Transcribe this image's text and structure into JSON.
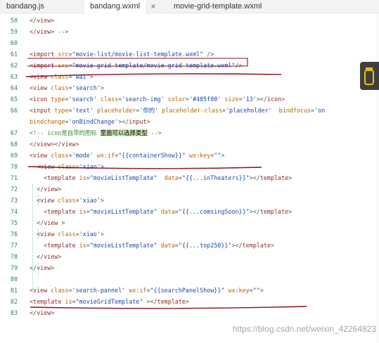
{
  "tabs": [
    {
      "label": "bandang.js",
      "active": false
    },
    {
      "label": "bandang.wxml",
      "active": true,
      "close": "×"
    },
    {
      "label": "movie-grid-template.wxml",
      "active": false
    }
  ],
  "lines": [
    {
      "no": "58",
      "segs": [
        {
          "c": "p",
          "t": "</"
        },
        {
          "c": "t",
          "t": "view"
        },
        {
          "c": "p",
          "t": ">"
        }
      ]
    },
    {
      "no": "59",
      "segs": [
        {
          "c": "p",
          "t": "</"
        },
        {
          "c": "t",
          "t": "view"
        },
        {
          "c": "p",
          "t": "> -->"
        }
      ]
    },
    {
      "no": "60",
      "segs": []
    },
    {
      "no": "61",
      "segs": [
        {
          "c": "p",
          "t": "<"
        },
        {
          "c": "t",
          "t": "import"
        },
        {
          "c": "a",
          "t": " src"
        },
        {
          "c": "p",
          "t": "="
        },
        {
          "c": "s",
          "t": "\"movie-list/movie-list-template.wxml\""
        },
        {
          "c": "p",
          "t": " />"
        }
      ]
    },
    {
      "no": "62",
      "segs": [
        {
          "c": "p",
          "t": "<"
        },
        {
          "c": "t",
          "t": "import"
        },
        {
          "c": "a",
          "t": " src"
        },
        {
          "c": "p",
          "t": "="
        },
        {
          "c": "s",
          "t": "\"movie-grid-template/movie-grid-template.wxml\""
        },
        {
          "c": "p",
          "t": "/>"
        }
      ]
    },
    {
      "no": "63",
      "segs": [
        {
          "c": "p",
          "t": "<"
        },
        {
          "c": "t",
          "t": "view"
        },
        {
          "c": "a",
          "t": " class"
        },
        {
          "c": "p",
          "t": "="
        },
        {
          "c": "s",
          "t": "'wai'"
        },
        {
          "c": "p",
          "t": ">"
        }
      ]
    },
    {
      "no": "64",
      "segs": [
        {
          "c": "p",
          "t": "<"
        },
        {
          "c": "t",
          "t": "view"
        },
        {
          "c": "a",
          "t": " class"
        },
        {
          "c": "p",
          "t": "="
        },
        {
          "c": "s",
          "t": "'search'"
        },
        {
          "c": "p",
          "t": ">"
        }
      ]
    },
    {
      "no": "65",
      "segs": [
        {
          "c": "p",
          "t": "<"
        },
        {
          "c": "t",
          "t": "icon"
        },
        {
          "c": "a",
          "t": " type"
        },
        {
          "c": "p",
          "t": "="
        },
        {
          "c": "s",
          "t": "'search'"
        },
        {
          "c": "a",
          "t": " class"
        },
        {
          "c": "p",
          "t": "="
        },
        {
          "c": "s",
          "t": "'search-img'"
        },
        {
          "c": "a",
          "t": " color"
        },
        {
          "c": "p",
          "t": "="
        },
        {
          "c": "s",
          "t": "'#405f80'"
        },
        {
          "c": "a",
          "t": " size"
        },
        {
          "c": "p",
          "t": "="
        },
        {
          "c": "s",
          "t": "'13'"
        },
        {
          "c": "p",
          "t": "></"
        },
        {
          "c": "t",
          "t": "icon"
        },
        {
          "c": "p",
          "t": ">"
        }
      ]
    },
    {
      "no": "66",
      "segs": [
        {
          "c": "p",
          "t": "<"
        },
        {
          "c": "t",
          "t": "input"
        },
        {
          "c": "a",
          "t": " type"
        },
        {
          "c": "p",
          "t": "="
        },
        {
          "c": "s",
          "t": "'text'"
        },
        {
          "c": "a",
          "t": " placeholder"
        },
        {
          "c": "p",
          "t": "="
        },
        {
          "c": "s",
          "t": "'你的'"
        },
        {
          "c": "a",
          "t": " placeholder-class"
        },
        {
          "c": "p",
          "t": "="
        },
        {
          "c": "s",
          "t": "'placeholder'"
        },
        {
          "c": "a",
          "t": "  bindfocus"
        },
        {
          "c": "p",
          "t": "="
        },
        {
          "c": "s",
          "t": "'on"
        }
      ]
    },
    {
      "no": "",
      "segs": [
        {
          "c": "a",
          "t": "bindchange"
        },
        {
          "c": "p",
          "t": "="
        },
        {
          "c": "s",
          "t": "'onBindChange'"
        },
        {
          "c": "p",
          "t": "></"
        },
        {
          "c": "t",
          "t": "input"
        },
        {
          "c": "p",
          "t": ">"
        }
      ]
    },
    {
      "no": "67",
      "segs": [
        {
          "c": "c",
          "t": "<!-- icon是自带的图标 "
        },
        {
          "c": "hl",
          "t": "里面可以选择类型"
        },
        {
          "c": "c",
          "t": " -->"
        }
      ]
    },
    {
      "no": "68",
      "segs": [
        {
          "c": "p",
          "t": "</"
        },
        {
          "c": "t",
          "t": "view"
        },
        {
          "c": "p",
          "t": "></"
        },
        {
          "c": "t",
          "t": "view"
        },
        {
          "c": "p",
          "t": ">"
        }
      ]
    },
    {
      "no": "69",
      "segs": [
        {
          "c": "p",
          "t": "<"
        },
        {
          "c": "t",
          "t": "view"
        },
        {
          "c": "a",
          "t": " class"
        },
        {
          "c": "p",
          "t": "="
        },
        {
          "c": "s",
          "t": "'mode'"
        },
        {
          "c": "a",
          "t": " wx:if"
        },
        {
          "c": "p",
          "t": "="
        },
        {
          "c": "s",
          "t": "\"{{containerShow}}\""
        },
        {
          "c": "a",
          "t": " wx:key"
        },
        {
          "c": "p",
          "t": "="
        },
        {
          "c": "s",
          "t": "\"\""
        },
        {
          "c": "p",
          "t": ">"
        }
      ]
    },
    {
      "no": "70",
      "segs": [
        {
          "c": "p",
          "t": "  <"
        },
        {
          "c": "t",
          "t": "view"
        },
        {
          "c": "a",
          "t": " class"
        },
        {
          "c": "p",
          "t": "="
        },
        {
          "c": "s",
          "t": "'xiao'"
        },
        {
          "c": "p",
          "t": ">"
        }
      ]
    },
    {
      "no": "71",
      "segs": [
        {
          "c": "p",
          "t": "    <"
        },
        {
          "c": "t",
          "t": "template"
        },
        {
          "c": "a",
          "t": " is"
        },
        {
          "c": "p",
          "t": "="
        },
        {
          "c": "s",
          "t": "\"movieListTemplate\""
        },
        {
          "c": "a",
          "t": "  data"
        },
        {
          "c": "p",
          "t": "="
        },
        {
          "c": "s",
          "t": "\"{{...inTheaters}}\""
        },
        {
          "c": "p",
          "t": "></"
        },
        {
          "c": "t",
          "t": "template"
        },
        {
          "c": "p",
          "t": ">"
        }
      ]
    },
    {
      "no": "72",
      "segs": [
        {
          "c": "p",
          "t": "  </"
        },
        {
          "c": "t",
          "t": "view"
        },
        {
          "c": "p",
          "t": ">"
        }
      ]
    },
    {
      "no": "73",
      "segs": [
        {
          "c": "p",
          "t": "  <"
        },
        {
          "c": "t",
          "t": "view"
        },
        {
          "c": "a",
          "t": " class"
        },
        {
          "c": "p",
          "t": "="
        },
        {
          "c": "s",
          "t": "'xiao'"
        },
        {
          "c": "p",
          "t": ">"
        }
      ]
    },
    {
      "no": "74",
      "segs": [
        {
          "c": "p",
          "t": "    <"
        },
        {
          "c": "t",
          "t": "template"
        },
        {
          "c": "a",
          "t": " is"
        },
        {
          "c": "p",
          "t": "="
        },
        {
          "c": "s",
          "t": "\"movieListTemplate\""
        },
        {
          "c": "a",
          "t": " data"
        },
        {
          "c": "p",
          "t": "="
        },
        {
          "c": "s",
          "t": "\"{{...comsingSoon}}\""
        },
        {
          "c": "p",
          "t": "></"
        },
        {
          "c": "t",
          "t": "template"
        },
        {
          "c": "p",
          "t": ">"
        }
      ]
    },
    {
      "no": "75",
      "segs": [
        {
          "c": "p",
          "t": "  </"
        },
        {
          "c": "t",
          "t": "view"
        },
        {
          "c": "p",
          "t": " >"
        }
      ]
    },
    {
      "no": "76",
      "segs": [
        {
          "c": "p",
          "t": "  <"
        },
        {
          "c": "t",
          "t": "view"
        },
        {
          "c": "a",
          "t": " class"
        },
        {
          "c": "p",
          "t": "="
        },
        {
          "c": "s",
          "t": "'xiao'"
        },
        {
          "c": "p",
          "t": ">"
        }
      ]
    },
    {
      "no": "77",
      "segs": [
        {
          "c": "p",
          "t": "    <"
        },
        {
          "c": "t",
          "t": "template"
        },
        {
          "c": "a",
          "t": " is"
        },
        {
          "c": "p",
          "t": "="
        },
        {
          "c": "s",
          "t": "\"movieListTemplate\""
        },
        {
          "c": "a",
          "t": " data"
        },
        {
          "c": "p",
          "t": "="
        },
        {
          "c": "s",
          "t": "\"{{...top250}}\""
        },
        {
          "c": "p",
          "t": "></"
        },
        {
          "c": "t",
          "t": "template"
        },
        {
          "c": "p",
          "t": ">"
        }
      ]
    },
    {
      "no": "78",
      "segs": [
        {
          "c": "p",
          "t": "  </"
        },
        {
          "c": "t",
          "t": "view"
        },
        {
          "c": "p",
          "t": ">"
        }
      ]
    },
    {
      "no": "79",
      "segs": [
        {
          "c": "p",
          "t": "</"
        },
        {
          "c": "t",
          "t": "view"
        },
        {
          "c": "p",
          "t": ">"
        }
      ]
    },
    {
      "no": "80",
      "segs": []
    },
    {
      "no": "81",
      "segs": [
        {
          "c": "p",
          "t": "<"
        },
        {
          "c": "t",
          "t": "view"
        },
        {
          "c": "a",
          "t": " class"
        },
        {
          "c": "p",
          "t": "="
        },
        {
          "c": "s",
          "t": "'search-pannel'"
        },
        {
          "c": "a",
          "t": " wx:if"
        },
        {
          "c": "p",
          "t": "="
        },
        {
          "c": "s",
          "t": "\"{{searchPanelShow}}\""
        },
        {
          "c": "a",
          "t": " wx:key"
        },
        {
          "c": "p",
          "t": "="
        },
        {
          "c": "s",
          "t": "\"\""
        },
        {
          "c": "p",
          "t": ">"
        }
      ]
    },
    {
      "no": "82",
      "segs": [
        {
          "c": "p",
          "t": "<"
        },
        {
          "c": "t",
          "t": "template"
        },
        {
          "c": "a",
          "t": " is"
        },
        {
          "c": "p",
          "t": "="
        },
        {
          "c": "s",
          "t": "\"movieGridTemplate\""
        },
        {
          "c": "p",
          "t": " ></"
        },
        {
          "c": "t",
          "t": "template"
        },
        {
          "c": "p",
          "t": ">"
        }
      ]
    },
    {
      "no": "83",
      "segs": [
        {
          "c": "p",
          "t": "</"
        },
        {
          "c": "t",
          "t": "view"
        },
        {
          "c": "p",
          "t": ">"
        }
      ]
    }
  ],
  "watermark": "https://blog.csdn.net/weixin_42264823",
  "colors": {
    "annotation": "#8b0f1a",
    "tag": "#8c2a2a",
    "attr": "#b26a00",
    "string": "#1a4aa8",
    "comment": "#3f8a3f",
    "highlight": "#cfe9b3"
  }
}
